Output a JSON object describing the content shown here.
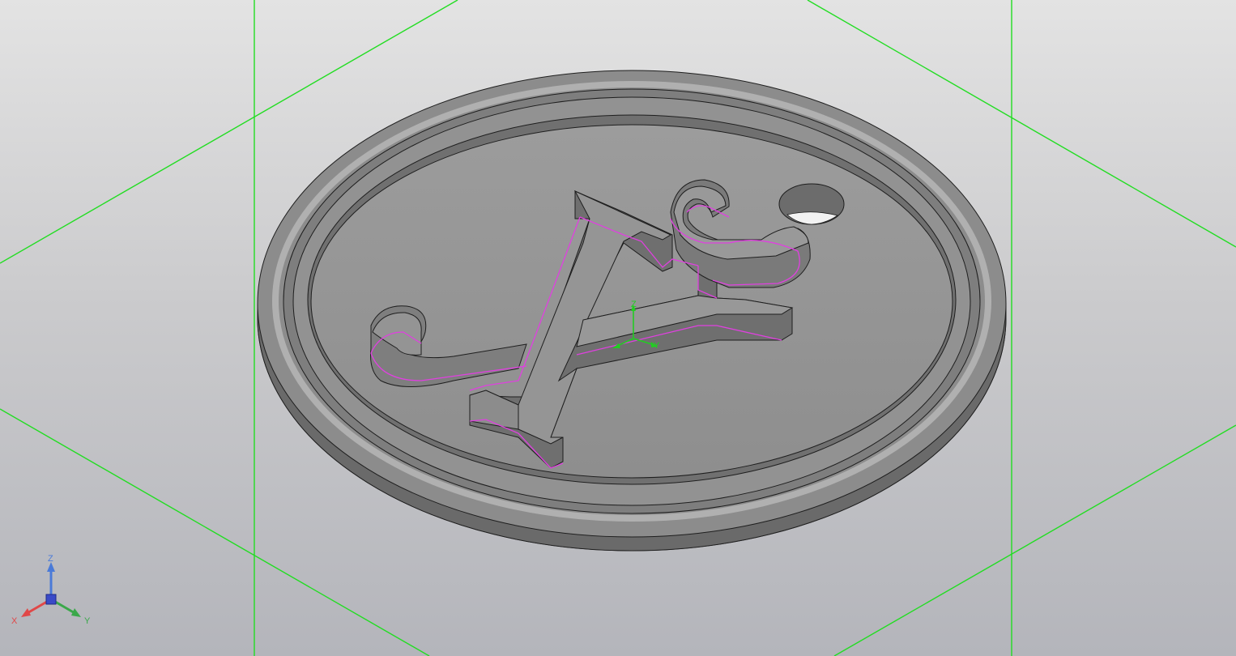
{
  "colors": {
    "grid": "#22dd22",
    "sketch_outline": "#e040e0",
    "part_body": "#8a8a8a",
    "part_edge": "#1e1e1e",
    "axis_x": "#e04848",
    "axis_y": "#3aa84a",
    "axis_z": "#4a7ad8"
  },
  "view_triad": {
    "x_label": "X",
    "y_label": "Y",
    "z_label": "Z"
  },
  "origin_triad": {
    "y_label": "Y",
    "z_label": "Z"
  }
}
